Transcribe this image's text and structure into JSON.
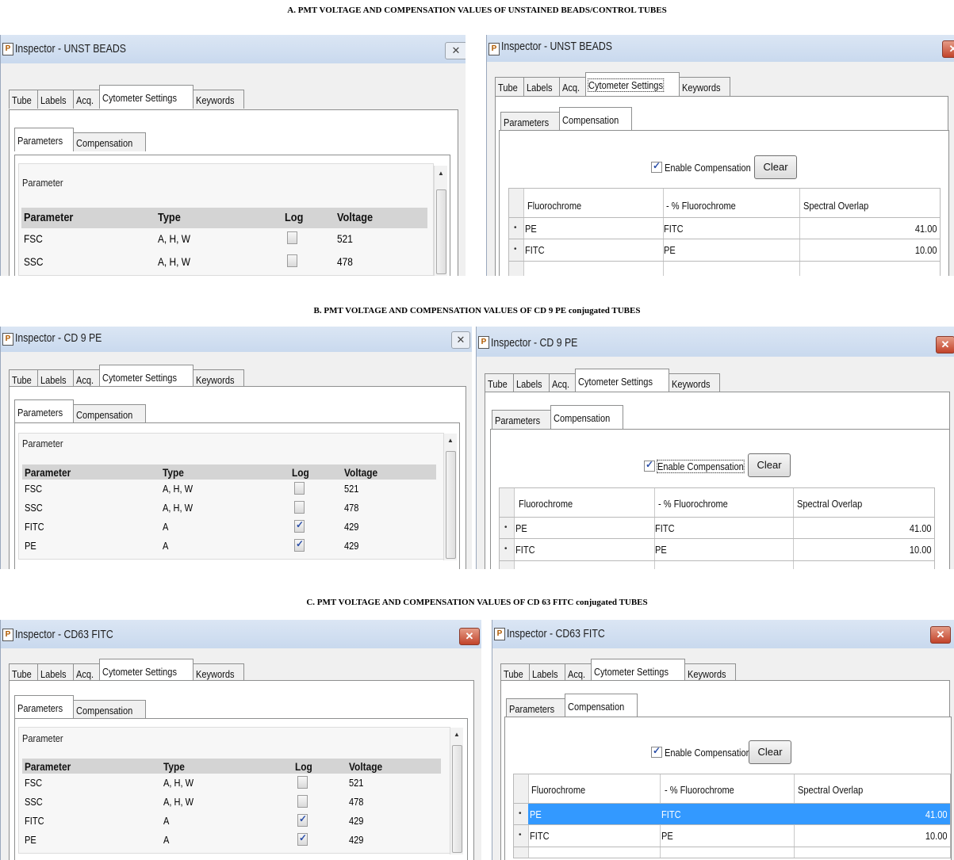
{
  "sections": [
    {
      "title": "A. PMT VOLTAGE AND COMPENSATION VALUES OF UNSTAINED BEADS/CONTROL TUBES",
      "left": {
        "window_title": "Inspector - UNST BEADS",
        "tabs": [
          "Tube",
          "Labels",
          "Acq.",
          "Cytometer Settings",
          "Keywords"
        ],
        "subtabs": [
          "Parameters",
          "Compensation"
        ],
        "group_label": "Parameter",
        "columns": [
          "Parameter",
          "Type",
          "Log",
          "Voltage"
        ],
        "rows": [
          {
            "parameter": "FSC",
            "type": "A, H, W",
            "log": false,
            "voltage": "521"
          },
          {
            "parameter": "SSC",
            "type": "A, H, W",
            "log": false,
            "voltage": "478"
          }
        ]
      },
      "right": {
        "window_title": "Inspector - UNST BEADS",
        "tabs": [
          "Tube",
          "Labels",
          "Acq.",
          "Cytometer Settings",
          "Keywords"
        ],
        "subtabs": [
          "Parameters",
          "Compensation"
        ],
        "enable_label": "Enable Compensation",
        "clear_label": "Clear",
        "columns": [
          "Fluorochrome",
          "- % Fluorochrome",
          "Spectral Overlap"
        ],
        "rows": [
          {
            "fluorochrome": "PE",
            "minus": "FITC",
            "overlap": "41.00"
          },
          {
            "fluorochrome": "FITC",
            "minus": "PE",
            "overlap": "10.00"
          }
        ]
      }
    },
    {
      "title": "B. PMT VOLTAGE AND COMPENSATION VALUES OF CD 9 PE conjugated TUBES",
      "left": {
        "window_title": "Inspector - CD 9 PE",
        "tabs": [
          "Tube",
          "Labels",
          "Acq.",
          "Cytometer Settings",
          "Keywords"
        ],
        "subtabs": [
          "Parameters",
          "Compensation"
        ],
        "group_label": "Parameter",
        "columns": [
          "Parameter",
          "Type",
          "Log",
          "Voltage"
        ],
        "rows": [
          {
            "parameter": "FSC",
            "type": "A, H, W",
            "log": false,
            "voltage": "521"
          },
          {
            "parameter": "SSC",
            "type": "A, H, W",
            "log": false,
            "voltage": "478"
          },
          {
            "parameter": "FITC",
            "type": "A",
            "log": true,
            "voltage": "429"
          },
          {
            "parameter": "PE",
            "type": "A",
            "log": true,
            "voltage": "429"
          }
        ]
      },
      "right": {
        "window_title": "Inspector - CD 9 PE",
        "tabs": [
          "Tube",
          "Labels",
          "Acq.",
          "Cytometer Settings",
          "Keywords"
        ],
        "subtabs": [
          "Parameters",
          "Compensation"
        ],
        "enable_label": "Enable Compensation",
        "clear_label": "Clear",
        "columns": [
          "Fluorochrome",
          "- % Fluorochrome",
          "Spectral Overlap"
        ],
        "rows": [
          {
            "fluorochrome": "PE",
            "minus": "FITC",
            "overlap": "41.00"
          },
          {
            "fluorochrome": "FITC",
            "minus": "PE",
            "overlap": "10.00"
          }
        ]
      }
    },
    {
      "title": "C. PMT VOLTAGE AND COMPENSATION VALUES OF CD 63 FITC conjugated TUBES",
      "left": {
        "window_title": "Inspector - CD63 FITC",
        "tabs": [
          "Tube",
          "Labels",
          "Acq.",
          "Cytometer Settings",
          "Keywords"
        ],
        "subtabs": [
          "Parameters",
          "Compensation"
        ],
        "group_label": "Parameter",
        "columns": [
          "Parameter",
          "Type",
          "Log",
          "Voltage"
        ],
        "rows": [
          {
            "parameter": "FSC",
            "type": "A, H, W",
            "log": false,
            "voltage": "521"
          },
          {
            "parameter": "SSC",
            "type": "A, H, W",
            "log": false,
            "voltage": "478"
          },
          {
            "parameter": "FITC",
            "type": "A",
            "log": true,
            "voltage": "429"
          },
          {
            "parameter": "PE",
            "type": "A",
            "log": true,
            "voltage": "429"
          }
        ]
      },
      "right": {
        "window_title": "Inspector - CD63 FITC",
        "tabs": [
          "Tube",
          "Labels",
          "Acq.",
          "Cytometer Settings",
          "Keywords"
        ],
        "subtabs": [
          "Parameters",
          "Compensation"
        ],
        "enable_label": "Enable Compensation",
        "clear_label": "Clear",
        "columns": [
          "Fluorochrome",
          "- % Fluorochrome",
          "Spectral Overlap"
        ],
        "rows": [
          {
            "fluorochrome": "PE",
            "minus": "FITC",
            "overlap": "41.00",
            "selected": true
          },
          {
            "fluorochrome": "FITC",
            "minus": "PE",
            "overlap": "10.00"
          }
        ]
      }
    }
  ],
  "colors": {
    "selection": "#3399ff",
    "close_button": "#c2432a",
    "header_row": "#d4d4d4"
  },
  "icons": {
    "window": "inspector-icon",
    "close": "close-icon",
    "check": "checkmark-icon"
  }
}
